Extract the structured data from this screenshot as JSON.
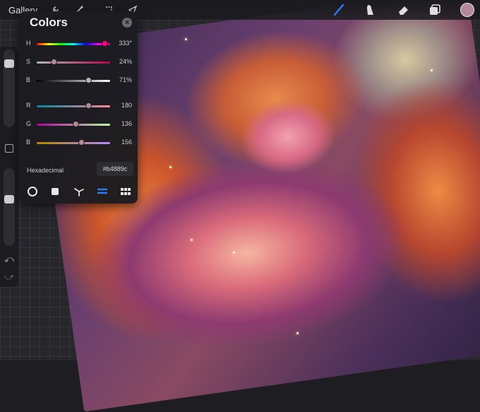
{
  "topbar": {
    "gallery_label": "Gallery",
    "tools": [
      "wrench-icon",
      "magic-icon",
      "selection-icon",
      "transform-icon"
    ],
    "right_tools": [
      "brush-icon",
      "smudge-icon",
      "eraser-icon",
      "layers-icon"
    ],
    "current_color": "#b4889c",
    "accent": "#2f7bf6"
  },
  "colors_panel": {
    "title": "Colors",
    "hsb": [
      {
        "label": "H",
        "value": "333°",
        "fraction": 0.925
      },
      {
        "label": "S",
        "value": "24%",
        "fraction": 0.24
      },
      {
        "label": "B",
        "value": "71%",
        "fraction": 0.71
      }
    ],
    "rgb": [
      {
        "label": "R",
        "value": "180",
        "fraction": 0.706
      },
      {
        "label": "G",
        "value": "136",
        "fraction": 0.533
      },
      {
        "label": "B",
        "value": "156",
        "fraction": 0.612
      }
    ],
    "hex_label": "Hexadecimal",
    "hex_value": "#b4889c",
    "modes": [
      "disc-icon",
      "classic-icon",
      "harmony-icon",
      "value-icon",
      "palettes-icon"
    ],
    "active_mode": "value-icon"
  },
  "sidebar": {
    "brush_size_level": 0.15,
    "opacity_level": 0.4
  }
}
